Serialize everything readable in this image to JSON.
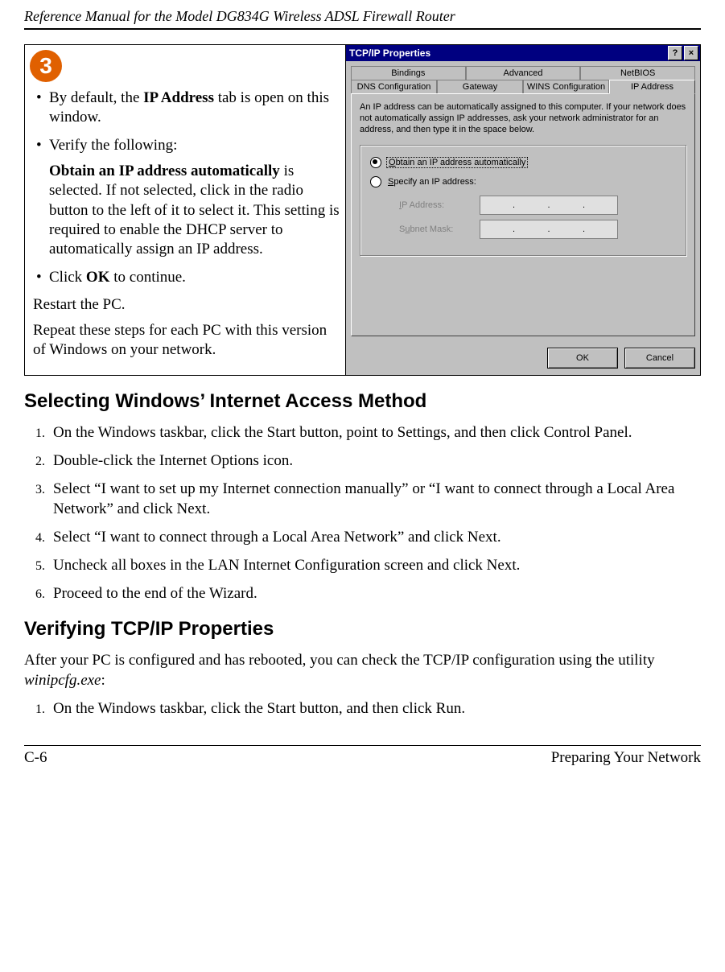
{
  "running_head": "Reference Manual for the Model DG834G Wireless ADSL Firewall Router",
  "step": {
    "badge": "3",
    "b1_a": "By default, the ",
    "b1_b": "IP Address",
    "b1_c": " tab is open on this window.",
    "b2": "Verify the following:",
    "b2_p_a": "Obtain an IP address automatically",
    "b2_p_b": " is selected. If not selected, click in the radio button to the left of it to select it.  This setting is required to enable the DHCP server to automatically assign an IP address.",
    "b3_a": "Click ",
    "b3_b": "OK",
    "b3_c": " to continue.",
    "p_restart": "Restart the PC.",
    "p_repeat": "Repeat these steps for each PC with this version of Windows on your network."
  },
  "dialog": {
    "title": "TCP/IP Properties",
    "btn_help": "?",
    "btn_close": "×",
    "tabs_row1": [
      "Bindings",
      "Advanced",
      "NetBIOS"
    ],
    "tabs_row2": [
      "DNS Configuration",
      "Gateway",
      "WINS Configuration",
      "IP Address"
    ],
    "active_tab_index": 3,
    "desc": "An IP address can be automatically assigned to this computer. If your network does not automatically assign IP addresses, ask your network administrator for an address, and then type it in the space below.",
    "radio_auto_u": "O",
    "radio_auto_rest": "btain an IP address automatically",
    "radio_spec_u": "S",
    "radio_spec_rest": "pecify an IP address:",
    "lbl_ip_u": "I",
    "lbl_ip_rest": "P Address:",
    "lbl_mask_pre": "S",
    "lbl_mask_u": "u",
    "lbl_mask_rest": "bnet Mask:",
    "ok": "OK",
    "cancel": "Cancel"
  },
  "h_select": "Selecting Windows’ Internet Access Method",
  "ol_select": [
    "On the Windows taskbar, click the Start button, point to Settings, and then click Control Panel.",
    "Double-click the Internet Options icon.",
    "Select “I want to set up my Internet connection manually” or “I want to connect through a Local Area Network” and click Next.",
    "Select “I want to connect through a Local Area Network” and click Next.",
    "Uncheck all boxes in the LAN Internet Configuration screen and click Next.",
    "Proceed to the end of the Wizard."
  ],
  "h_verify": "Verifying TCP/IP Properties",
  "p_verify_a": "After your PC is configured and has rebooted, you can check the TCP/IP configuration using the utility ",
  "p_verify_b": "winipcfg.exe",
  "p_verify_c": ":",
  "ol_verify": [
    "On the Windows taskbar, click the Start button, and then click Run."
  ],
  "footer_left": "C-6",
  "footer_right": "Preparing Your Network"
}
